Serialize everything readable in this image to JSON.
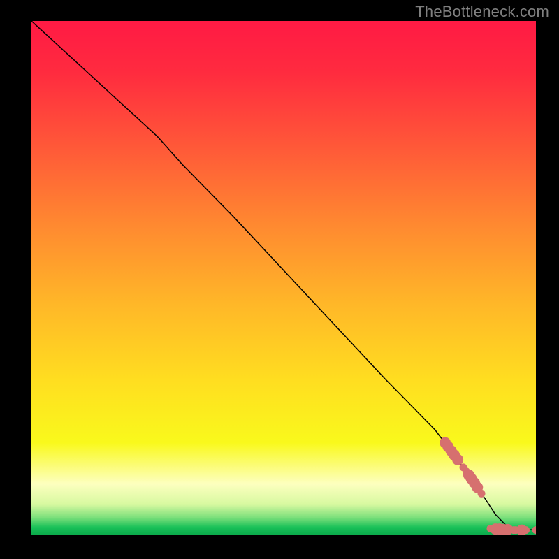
{
  "watermark": "TheBottleneck.com",
  "chart_data": {
    "type": "line",
    "title": "",
    "xlabel": "",
    "ylabel": "",
    "xlim": [
      0,
      100
    ],
    "ylim": [
      0,
      100
    ],
    "background_gradient": {
      "stops": [
        {
          "offset": 0.0,
          "color": "#ff1a44"
        },
        {
          "offset": 0.1,
          "color": "#ff2b3f"
        },
        {
          "offset": 0.25,
          "color": "#ff5a38"
        },
        {
          "offset": 0.4,
          "color": "#ff8a30"
        },
        {
          "offset": 0.55,
          "color": "#ffb728"
        },
        {
          "offset": 0.7,
          "color": "#ffde20"
        },
        {
          "offset": 0.82,
          "color": "#f9f91c"
        },
        {
          "offset": 0.9,
          "color": "#fdffbf"
        },
        {
          "offset": 0.94,
          "color": "#d7f9a0"
        },
        {
          "offset": 0.965,
          "color": "#7ee07c"
        },
        {
          "offset": 0.985,
          "color": "#18c058"
        },
        {
          "offset": 1.0,
          "color": "#0aa84a"
        }
      ]
    },
    "series": [
      {
        "name": "curve",
        "color": "#000000",
        "stroke_width": 1.5,
        "values": [
          {
            "x": 0.0,
            "y": 100.0
          },
          {
            "x": 10.0,
            "y": 91.0
          },
          {
            "x": 20.0,
            "y": 82.0
          },
          {
            "x": 25.0,
            "y": 77.5
          },
          {
            "x": 30.0,
            "y": 72.0
          },
          {
            "x": 40.0,
            "y": 62.0
          },
          {
            "x": 50.0,
            "y": 51.5
          },
          {
            "x": 60.0,
            "y": 41.0
          },
          {
            "x": 70.0,
            "y": 30.5
          },
          {
            "x": 80.0,
            "y": 20.5
          },
          {
            "x": 85.0,
            "y": 14.0
          },
          {
            "x": 90.0,
            "y": 7.0
          },
          {
            "x": 92.0,
            "y": 4.0
          },
          {
            "x": 94.0,
            "y": 2.0
          },
          {
            "x": 96.0,
            "y": 1.2
          },
          {
            "x": 100.0,
            "y": 1.0
          }
        ]
      }
    ],
    "scatter_overlay": {
      "name": "highlight-markers",
      "color": "#d6706f",
      "radius_small": 5.5,
      "radius_large": 8,
      "points": [
        {
          "x": 82.0,
          "y": 18.0,
          "r": "large"
        },
        {
          "x": 82.6,
          "y": 17.2,
          "r": "large"
        },
        {
          "x": 83.2,
          "y": 16.4,
          "r": "large"
        },
        {
          "x": 83.8,
          "y": 15.6,
          "r": "large"
        },
        {
          "x": 84.5,
          "y": 14.7,
          "r": "large"
        },
        {
          "x": 85.6,
          "y": 13.2,
          "r": "small"
        },
        {
          "x": 86.2,
          "y": 12.4,
          "r": "small"
        },
        {
          "x": 86.7,
          "y": 11.7,
          "r": "large"
        },
        {
          "x": 87.2,
          "y": 11.0,
          "r": "large"
        },
        {
          "x": 87.8,
          "y": 10.2,
          "r": "large"
        },
        {
          "x": 88.4,
          "y": 9.3,
          "r": "large"
        },
        {
          "x": 89.2,
          "y": 8.1,
          "r": "small"
        },
        {
          "x": 91.0,
          "y": 1.3,
          "r": "small"
        },
        {
          "x": 92.0,
          "y": 1.2,
          "r": "large"
        },
        {
          "x": 92.8,
          "y": 1.2,
          "r": "large"
        },
        {
          "x": 93.6,
          "y": 1.1,
          "r": "large"
        },
        {
          "x": 94.4,
          "y": 1.1,
          "r": "large"
        },
        {
          "x": 95.6,
          "y": 1.0,
          "r": "small"
        },
        {
          "x": 96.0,
          "y": 1.0,
          "r": "small"
        },
        {
          "x": 97.2,
          "y": 1.0,
          "r": "large"
        },
        {
          "x": 98.0,
          "y": 1.0,
          "r": "small"
        },
        {
          "x": 100.0,
          "y": 1.0,
          "r": "small"
        }
      ]
    }
  }
}
